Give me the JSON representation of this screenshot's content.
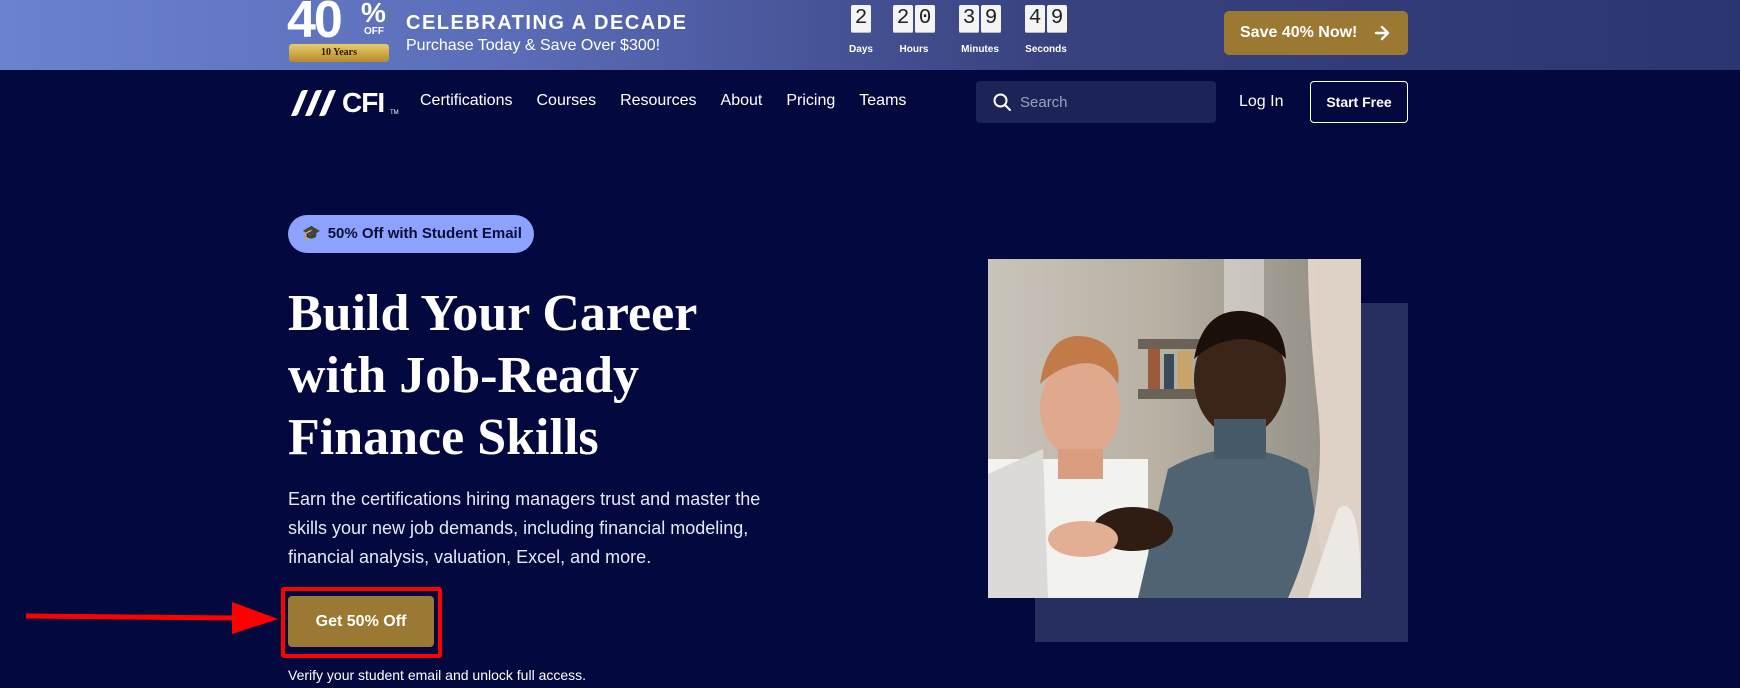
{
  "promo": {
    "badge_big": "40",
    "badge_pct": "%",
    "badge_off": "OFF",
    "badge_ribbon": "10 Years",
    "title": "CELEBRATING A DECADE",
    "subtitle": "Purchase Today & Save Over $300!",
    "countdown": {
      "days": {
        "digits": [
          "2"
        ],
        "label": "Days"
      },
      "hours": {
        "digits": [
          "2",
          "0"
        ],
        "label": "Hours"
      },
      "minutes": {
        "digits": [
          "3",
          "9"
        ],
        "label": "Minutes"
      },
      "seconds": {
        "digits": [
          "4",
          "9"
        ],
        "label": "Seconds"
      }
    },
    "cta_label": "Save 40% Now!",
    "cta_icon": "arrow-right-icon"
  },
  "nav": {
    "logo_text": "CFI",
    "logo_tm": "TM",
    "links": [
      "Certifications",
      "Courses",
      "Resources",
      "About",
      "Pricing",
      "Teams"
    ],
    "search_placeholder": "Search",
    "login_label": "Log In",
    "start_label": "Start Free"
  },
  "hero": {
    "pill_icon": "🎓",
    "pill_label": "50% Off with Student Email",
    "title_lines": [
      "Build Your Career",
      "with Job-Ready",
      "Finance Skills"
    ],
    "description_lines": [
      "Earn the certifications hiring managers trust and master the",
      "skills your new job demands, including financial modeling,",
      "financial analysis, valuation, Excel, and more."
    ],
    "cta_label": "Get 50% Off",
    "verify_text": "Verify your student email and unlock full access."
  },
  "colors": {
    "background": "#03093f",
    "gold": "#9c7932",
    "pill": "#8da1ff",
    "annotation": "#ff0000"
  }
}
